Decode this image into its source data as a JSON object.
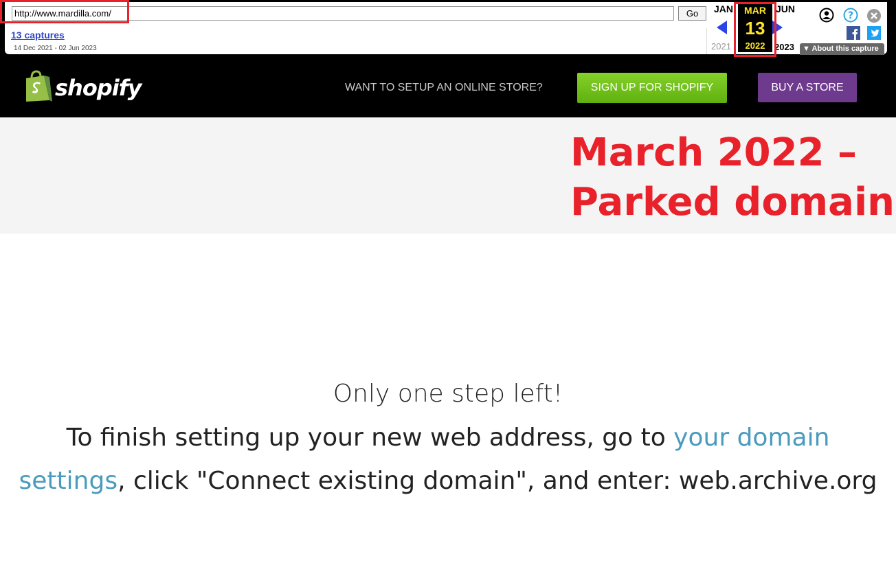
{
  "wayback": {
    "url": "http://www.mardilla.com/",
    "go_label": "Go",
    "captures_label": "13 captures",
    "date_range": "14 Dec 2021 - 02 Jun 2023",
    "prev_month": "JAN",
    "next_month": "JUN",
    "prev_year": "2021",
    "next_year": "2023",
    "current": {
      "month": "MAR",
      "day": "13",
      "year": "2022"
    },
    "about_label": "About this capture",
    "highlight_color": "#e8212a"
  },
  "header": {
    "logo_text": "shopify",
    "prompt": "WANT TO SETUP AN ONLINE STORE?",
    "signup_label": "SIGN UP FOR SHOPIFY",
    "buy_label": "BUY A STORE"
  },
  "annotation": {
    "line1": "March 2022 –",
    "line2": "Parked domain"
  },
  "main": {
    "heading": "Only one step left!",
    "text_before": "To finish setting up your new web address, go to ",
    "link_text": "your domain settings",
    "text_after": ", click \"Connect existing domain\", and enter: web.archive.org"
  }
}
